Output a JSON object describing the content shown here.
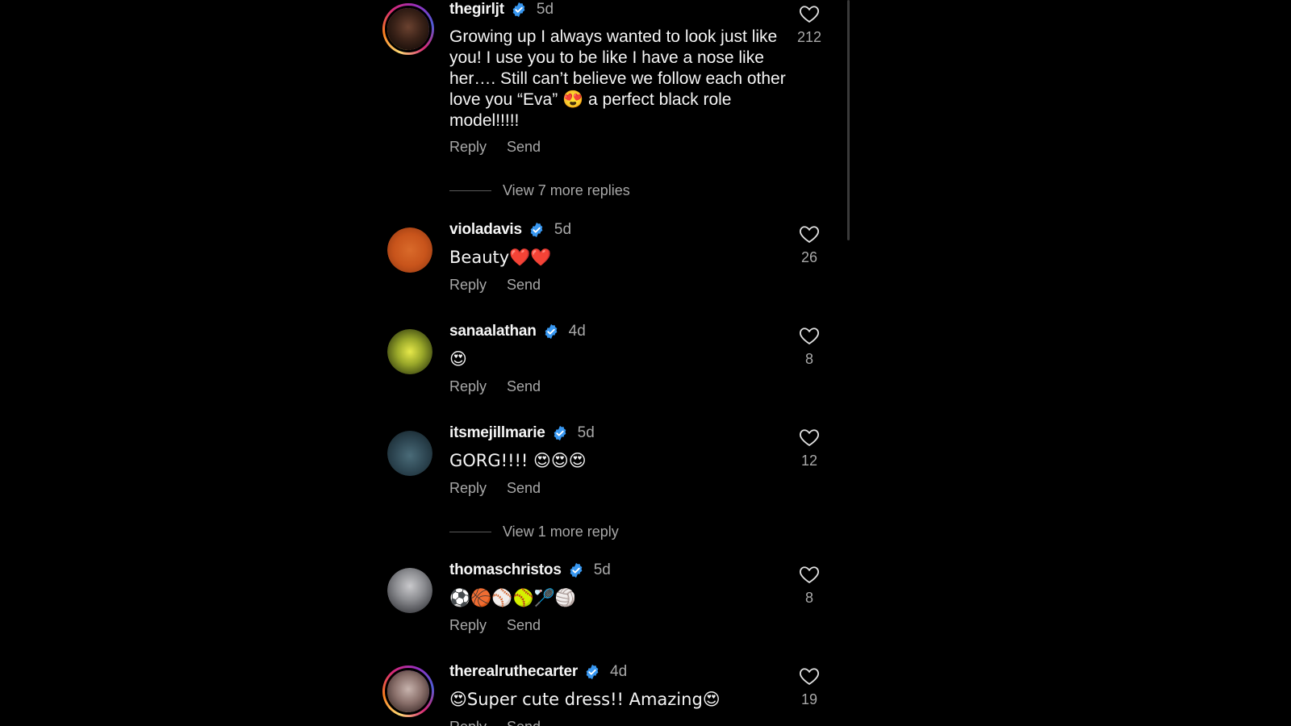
{
  "comments": [
    {
      "username": "thegirljt",
      "time": "5d",
      "text": "Growing up I always wanted to look just like you! I use you to be like I have a nose like her…. Still can’t believe we follow each other love you “Eva” 😍 a perfect black role model!!!!!",
      "likes": "212",
      "reply_label": "Reply",
      "send_label": "Send",
      "view_more": "View 7 more replies"
    },
    {
      "username": "violadavis",
      "time": "5d",
      "text": "Beauty❤️❤️",
      "likes": "26",
      "reply_label": "Reply",
      "send_label": "Send"
    },
    {
      "username": "sanaalathan",
      "time": "4d",
      "text": "😍",
      "likes": "8",
      "reply_label": "Reply",
      "send_label": "Send"
    },
    {
      "username": "itsmejillmarie",
      "time": "5d",
      "text": "GORG!!!! 😍😍😍",
      "likes": "12",
      "reply_label": "Reply",
      "send_label": "Send",
      "view_more": "View 1 more reply"
    },
    {
      "username": "thomaschristos",
      "time": "5d",
      "text": "⚽🏀⚾🥎🏸🏐",
      "likes": "8",
      "reply_label": "Reply",
      "send_label": "Send"
    },
    {
      "username": "therealruthecarter",
      "time": "4d",
      "text": "😍Super cute dress!! Amazing😍",
      "likes": "19",
      "reply_label": "Reply",
      "send_label": "Send"
    }
  ],
  "colors": {
    "background": "#000000",
    "text_primary": "#f5f5f5",
    "text_secondary": "#a8a8a8",
    "verified_badge": "#3897f0"
  },
  "icons": {
    "like": "heart-outline-icon",
    "verified": "verified-badge-icon"
  }
}
